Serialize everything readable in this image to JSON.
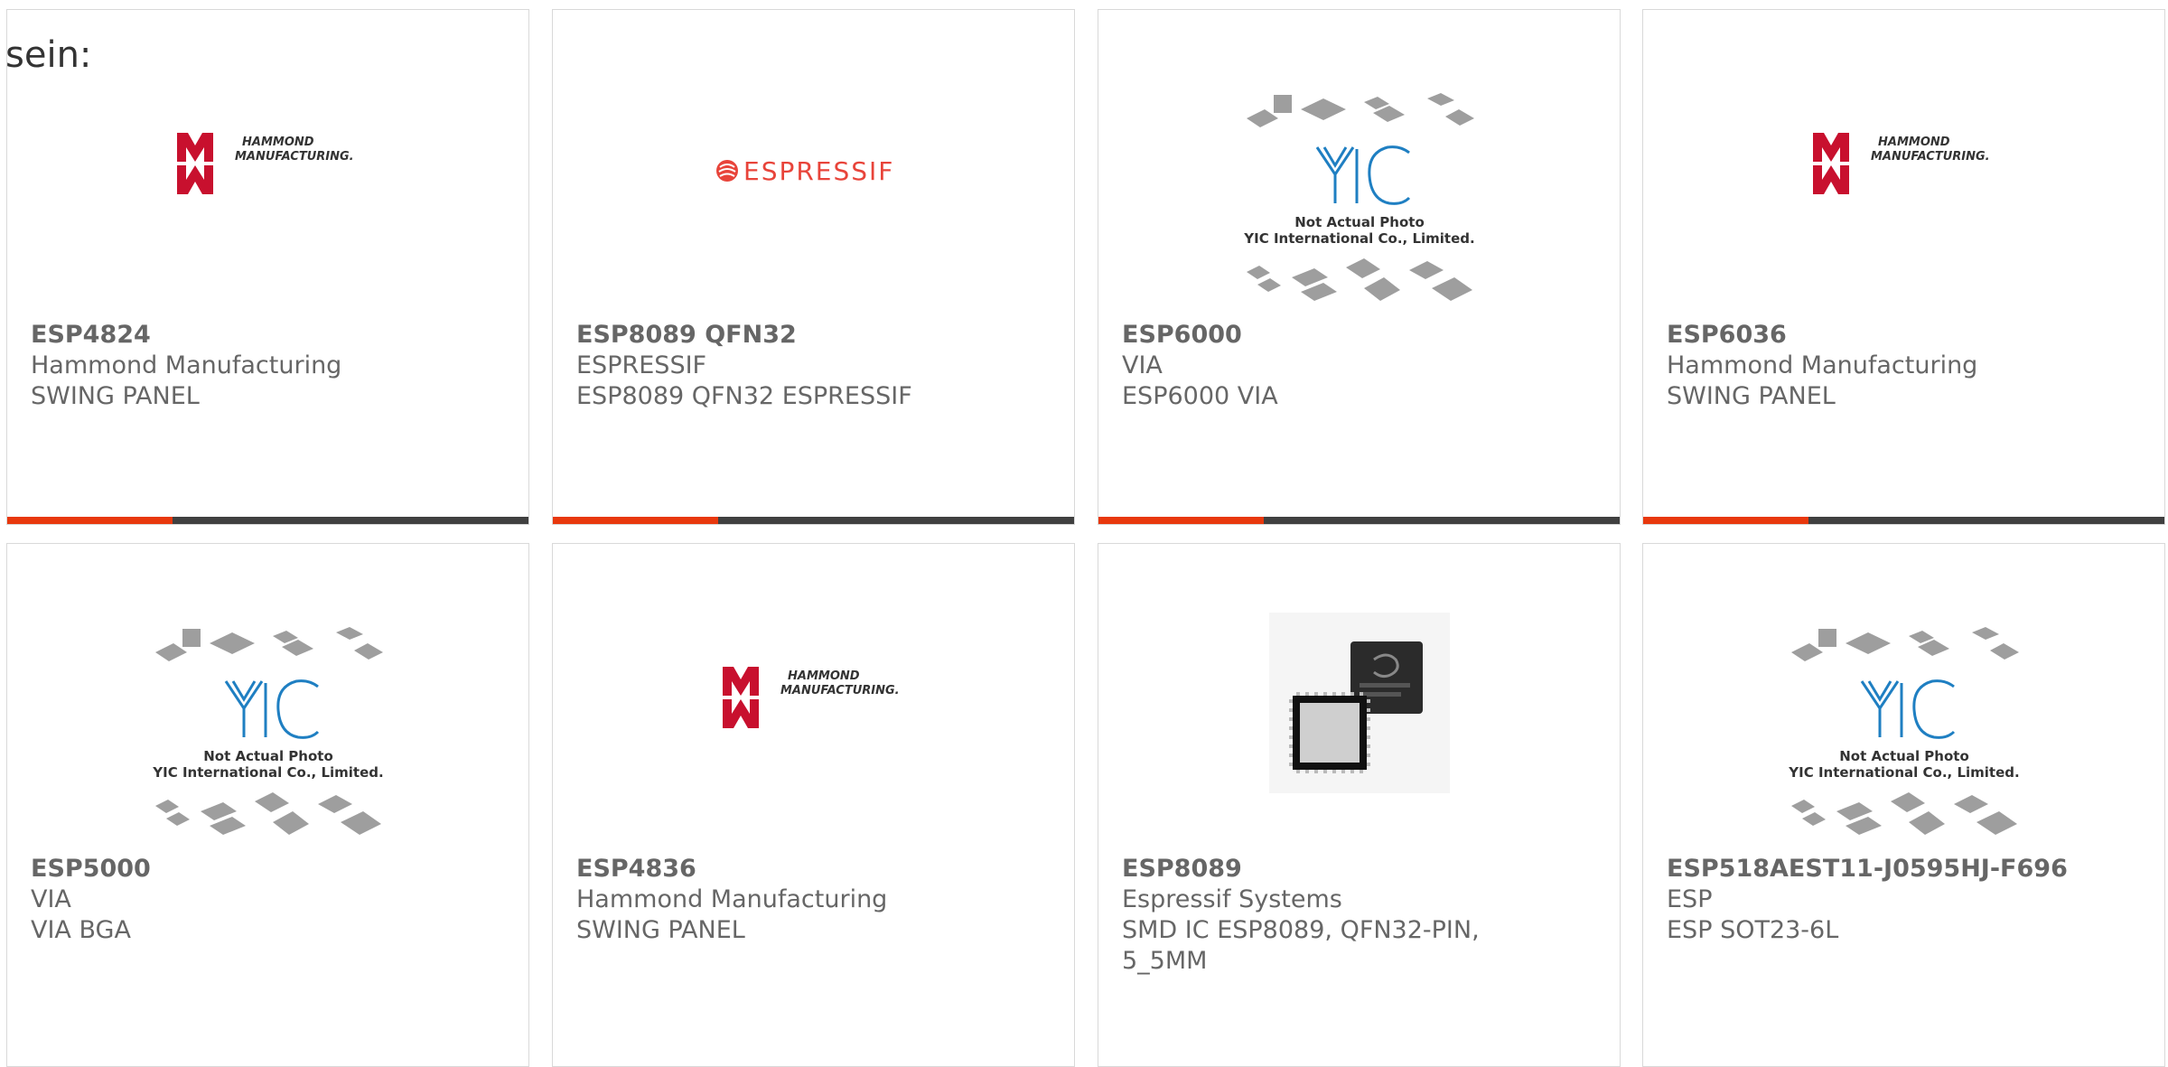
{
  "intro_text": "sein:",
  "colors": {
    "accent": "#e8380d",
    "bar": "#404040",
    "text": "#666666",
    "border": "#d9d9d9",
    "hammond_red": "#c8102e",
    "espressif_red": "#e8443a",
    "yic_blue": "#1f7fc2"
  },
  "logos": {
    "hammond_line1": "HAMMOND",
    "hammond_line2": "MANUFACTURING.",
    "espressif": "ESPRESSIF",
    "yic_mark": "YIC",
    "yic_line1": "Not Actual Photo",
    "yic_line2": "YIC International Co., Limited."
  },
  "products": [
    {
      "part": "ESP4824",
      "maker": "Hammond Manufacturing",
      "desc": "SWING PANEL",
      "image": "hammond-logo"
    },
    {
      "part": "ESP8089 QFN32",
      "maker": "ESPRESSIF",
      "desc": "ESP8089 QFN32 ESPRESSIF",
      "image": "espressif-logo"
    },
    {
      "part": "ESP6000",
      "maker": "VIA",
      "desc": "ESP6000 VIA",
      "image": "yic-placeholder"
    },
    {
      "part": "ESP6036",
      "maker": "Hammond Manufacturing",
      "desc": "SWING PANEL",
      "image": "hammond-logo"
    },
    {
      "part": "ESP5000",
      "maker": "VIA",
      "desc": "VIA BGA",
      "image": "yic-placeholder"
    },
    {
      "part": "ESP4836",
      "maker": "Hammond Manufacturing",
      "desc": "SWING PANEL",
      "image": "hammond-logo"
    },
    {
      "part": "ESP8089",
      "maker": "Espressif Systems",
      "desc": "SMD IC ESP8089, QFN32-PIN,",
      "desc2": "5_5MM",
      "image": "chip-photo"
    },
    {
      "part": "ESP518AEST11-J0595HJ-F696",
      "maker": "ESP",
      "desc": "ESP SOT23-6L",
      "image": "yic-placeholder"
    }
  ]
}
